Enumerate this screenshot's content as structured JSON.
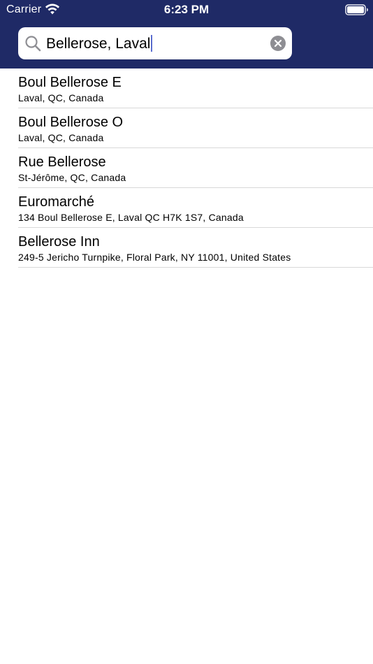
{
  "status_bar": {
    "carrier": "Carrier",
    "time": "6:23 PM",
    "wifi_icon": "wifi-icon",
    "battery_icon": "battery-icon"
  },
  "search": {
    "value": "Bellerose, Laval",
    "search_icon": "search-icon",
    "clear_icon": "clear-icon"
  },
  "results": [
    {
      "title": "Boul Bellerose E",
      "subtitle": "Laval, QC, Canada"
    },
    {
      "title": "Boul Bellerose O",
      "subtitle": "Laval, QC, Canada"
    },
    {
      "title": "Rue Bellerose",
      "subtitle": "St-Jérôme, QC, Canada"
    },
    {
      "title": "Euromarché",
      "subtitle": "134 Boul Bellerose E, Laval QC H7K 1S7, Canada"
    },
    {
      "title": "Bellerose Inn",
      "subtitle": "249-5 Jericho Turnpike, Floral Park, NY 11001, United States"
    }
  ],
  "colors": {
    "header_background": "#1f2a66",
    "caret": "#5c6fd1",
    "separator": "#d8d8d8"
  }
}
